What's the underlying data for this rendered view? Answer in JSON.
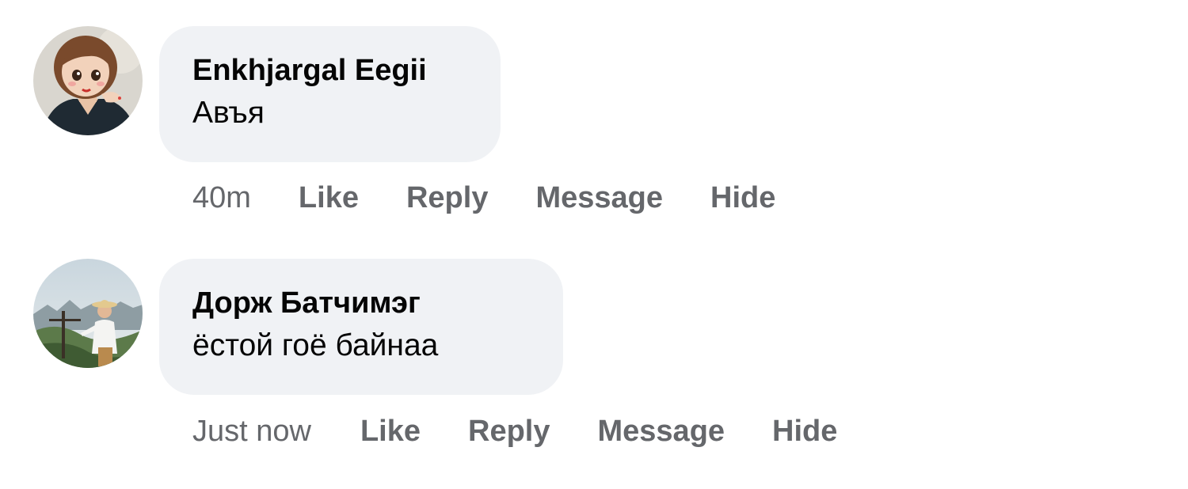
{
  "comments": [
    {
      "author": "Enkhjargal Eegii",
      "text": "Авъя",
      "time": "40m",
      "actions": {
        "like": "Like",
        "reply": "Reply",
        "message": "Message",
        "hide": "Hide"
      }
    },
    {
      "author": "Дорж Батчимэг",
      "text": "ёстой гоё байнаа",
      "time": "Just now",
      "actions": {
        "like": "Like",
        "reply": "Reply",
        "message": "Message",
        "hide": "Hide"
      }
    }
  ],
  "colors": {
    "bubble_bg": "#f0f2f5",
    "text": "#050505",
    "meta": "#65676b"
  }
}
